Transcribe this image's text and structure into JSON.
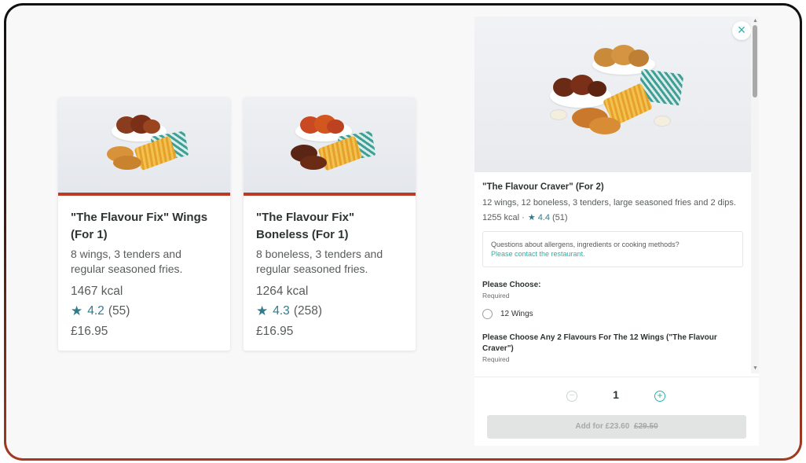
{
  "cards": [
    {
      "title": "\"The Flavour Fix\" Wings (For 1)",
      "description": "8 wings, 3 tenders and regular seasoned fries.",
      "kcal": "1467 kcal",
      "rating": "4.2",
      "rating_count": "(55)",
      "price": "£16.95"
    },
    {
      "title": "\"The Flavour Fix\" Boneless (For 1)",
      "description": "8 boneless, 3 tenders and regular seasoned fries.",
      "kcal": "1264 kcal",
      "rating": "4.3",
      "rating_count": "(258)",
      "price": "£16.95"
    }
  ],
  "modal": {
    "close_icon": "×",
    "title": "\"The Flavour Craver\" (For 2)",
    "description": "12 wings, 12 boneless, 3 tenders, large seasoned fries and 2 dips.",
    "kcal": "1255 kcal ·",
    "rating": "4.4",
    "rating_count": "(51)",
    "allergen_question": "Questions about allergens, ingredients or cooking methods?",
    "allergen_link": "Please contact the restaurant.",
    "section1_title": "Please Choose:",
    "section1_required": "Required",
    "section1_option": "12 Wings",
    "section2_title": "Please Choose Any 2 Flavours For The 12 Wings (\"The Flavour Craver\")",
    "section2_required": "Required",
    "quantity": "1",
    "minus_icon": "−",
    "plus_icon": "+",
    "add_label": "Add for £23.60",
    "add_old_price": "£29.50"
  },
  "colors": {
    "accent_teal": "#2fb0a6",
    "card_stripe": "#b83c28",
    "star": "#2f7d8c"
  }
}
